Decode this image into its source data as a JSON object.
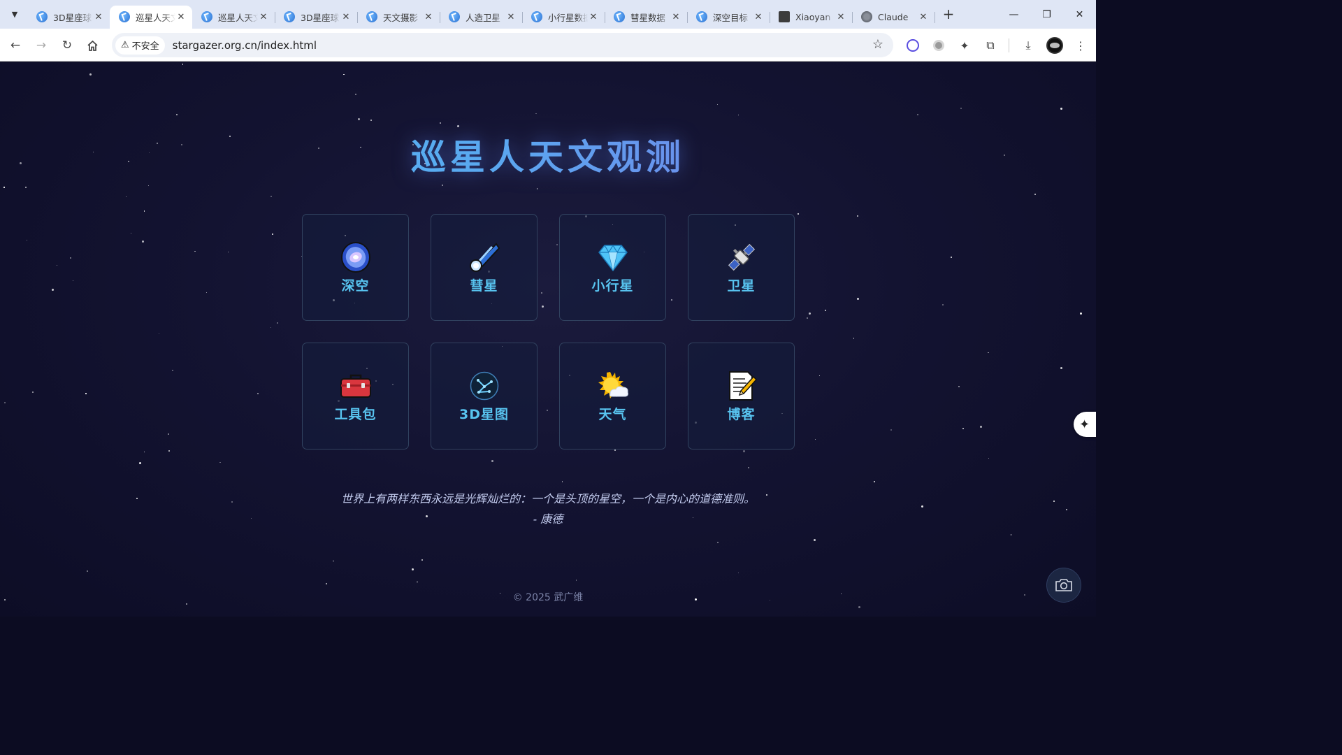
{
  "browser": {
    "tabs": [
      {
        "title": "3D星座球",
        "icon": "site-favicon",
        "active": false
      },
      {
        "title": "巡星人天文观测",
        "icon": "site-favicon",
        "active": true
      },
      {
        "title": "巡星人天文",
        "icon": "site-favicon",
        "active": false
      },
      {
        "title": "3D星座球",
        "icon": "site-favicon",
        "active": false
      },
      {
        "title": "天文摄影",
        "icon": "site-favicon",
        "active": false
      },
      {
        "title": "人造卫星",
        "icon": "site-favicon",
        "active": false
      },
      {
        "title": "小行星数据",
        "icon": "site-favicon",
        "active": false
      },
      {
        "title": "彗星数据",
        "icon": "site-favicon",
        "active": false
      },
      {
        "title": "深空目标",
        "icon": "site-favicon",
        "active": false
      },
      {
        "title": "Xiaoyan",
        "icon": "as-favicon",
        "active": false
      },
      {
        "title": "Claude",
        "icon": "globe-favicon",
        "active": false
      }
    ],
    "security_label": "不安全",
    "url": "stargazer.org.cn/index.html"
  },
  "page": {
    "title": "巡星人天文观测",
    "cards": [
      {
        "label": "深空",
        "icon": "galaxy-icon"
      },
      {
        "label": "彗星",
        "icon": "comet-icon"
      },
      {
        "label": "小行星",
        "icon": "gem-icon"
      },
      {
        "label": "卫星",
        "icon": "satellite-icon"
      },
      {
        "label": "工具包",
        "icon": "toolbox-icon"
      },
      {
        "label": "3D星图",
        "icon": "constellation-icon"
      },
      {
        "label": "天气",
        "icon": "weather-icon"
      },
      {
        "label": "博客",
        "icon": "memo-icon"
      }
    ],
    "quote": "世界上有两样东西永远是光辉灿烂的：一个是头顶的星空，一个是内心的道德准则。",
    "quote_author": "- 康德",
    "footer": "© 2025 武广维"
  },
  "colors": {
    "accent": "#58c4f0",
    "title_gradient_start": "#4dc6f5",
    "title_gradient_end": "#8a63e6"
  }
}
